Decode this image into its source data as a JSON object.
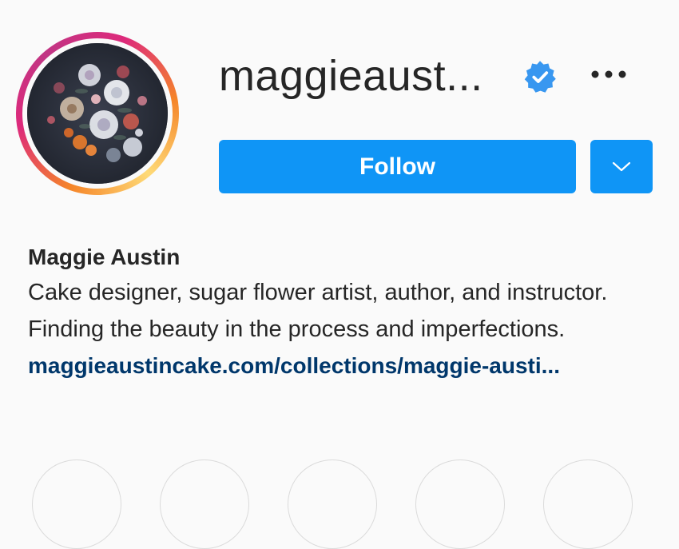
{
  "profile": {
    "username": "maggieaust...",
    "verified": true,
    "full_name": "Maggie Austin",
    "bio": "Cake designer, sugar flower artist, author, and instructor. Finding the beauty in the process and imperfections.",
    "link": "maggieaustincake.com/collections/maggie-austi..."
  },
  "actions": {
    "follow_label": "Follow"
  },
  "icons": {
    "verified": "verified-badge-icon",
    "more": "more-options-icon",
    "dropdown": "chevron-down-icon"
  },
  "colors": {
    "primary_button": "#0f95f6",
    "verified_badge": "#3897f0",
    "link": "#00376b",
    "text": "#262626",
    "background": "#fafafa"
  },
  "highlights": [
    {
      "name": ""
    },
    {
      "name": ""
    },
    {
      "name": ""
    },
    {
      "name": ""
    },
    {
      "name": ""
    }
  ]
}
